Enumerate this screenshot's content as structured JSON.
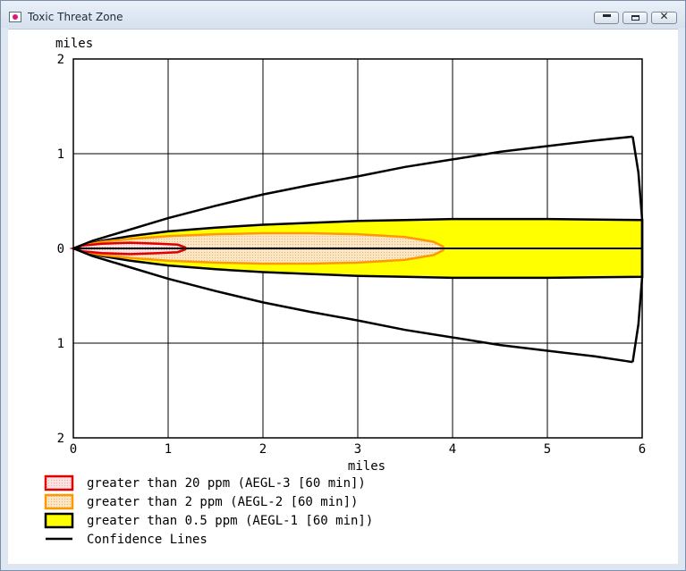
{
  "window": {
    "title": "Toxic Threat Zone",
    "icon": "app-window-icon"
  },
  "controls": {
    "minimize_icon": "minimize-icon",
    "maximize_icon": "maximize-icon",
    "close_icon": "close-icon",
    "close_glyph": "✕"
  },
  "chart_data": {
    "type": "area",
    "xlabel": "miles",
    "ylabel": "miles",
    "xlim": [
      0,
      6
    ],
    "ylim": [
      -2,
      2
    ],
    "x_ticks": [
      0,
      1,
      2,
      3,
      4,
      5,
      6
    ],
    "x_tick_labels": [
      "0",
      "1",
      "2",
      "3",
      "4",
      "5",
      "6"
    ],
    "y_ticks": [
      2,
      1,
      0,
      -1,
      -2
    ],
    "y_tick_labels": [
      "2",
      "1",
      "0",
      "1",
      "2"
    ],
    "grid": true,
    "legend_placement": "bottom-left",
    "centerline": [
      [
        0,
        0
      ],
      [
        6,
        0
      ]
    ],
    "zones": [
      {
        "name": "greater than 0.5 ppm (AEGL-1 [60 min])",
        "fill": "#ffff00",
        "stroke": "#000000",
        "upper": [
          [
            0,
            0
          ],
          [
            0.1,
            0.03
          ],
          [
            0.3,
            0.08
          ],
          [
            0.6,
            0.13
          ],
          [
            1,
            0.18
          ],
          [
            1.5,
            0.22
          ],
          [
            2,
            0.25
          ],
          [
            2.5,
            0.27
          ],
          [
            3,
            0.29
          ],
          [
            3.5,
            0.3
          ],
          [
            4,
            0.31
          ],
          [
            5,
            0.31
          ],
          [
            6,
            0.3
          ]
        ],
        "lower": [
          [
            0,
            0
          ],
          [
            0.1,
            -0.03
          ],
          [
            0.3,
            -0.08
          ],
          [
            0.6,
            -0.13
          ],
          [
            1,
            -0.18
          ],
          [
            1.5,
            -0.22
          ],
          [
            2,
            -0.25
          ],
          [
            2.5,
            -0.27
          ],
          [
            3,
            -0.29
          ],
          [
            3.5,
            -0.3
          ],
          [
            4,
            -0.31
          ],
          [
            5,
            -0.31
          ],
          [
            6,
            -0.3
          ]
        ]
      },
      {
        "name": "greater than 2 ppm (AEGL-2 [60 min])",
        "fill": "#fbe6bf",
        "stroke": "#ff9900",
        "upper": [
          [
            0,
            0
          ],
          [
            0.1,
            0.03
          ],
          [
            0.3,
            0.07
          ],
          [
            0.6,
            0.1
          ],
          [
            1,
            0.13
          ],
          [
            1.5,
            0.15
          ],
          [
            2,
            0.16
          ],
          [
            2.5,
            0.16
          ],
          [
            3,
            0.15
          ],
          [
            3.5,
            0.12
          ],
          [
            3.8,
            0.07
          ],
          [
            3.9,
            0.02
          ]
        ],
        "lower": [
          [
            0,
            0
          ],
          [
            0.1,
            -0.03
          ],
          [
            0.3,
            -0.07
          ],
          [
            0.6,
            -0.1
          ],
          [
            1,
            -0.13
          ],
          [
            1.5,
            -0.15
          ],
          [
            2,
            -0.16
          ],
          [
            2.5,
            -0.16
          ],
          [
            3,
            -0.15
          ],
          [
            3.5,
            -0.12
          ],
          [
            3.8,
            -0.07
          ],
          [
            3.9,
            -0.02
          ]
        ]
      },
      {
        "name": "greater than 20 ppm (AEGL-3 [60 min])",
        "fill": "#fbe1e1",
        "stroke": "#e00000",
        "upper": [
          [
            0,
            0
          ],
          [
            0.1,
            0.03
          ],
          [
            0.3,
            0.05
          ],
          [
            0.6,
            0.06
          ],
          [
            0.9,
            0.05
          ],
          [
            1.1,
            0.04
          ],
          [
            1.18,
            0.01
          ]
        ],
        "lower": [
          [
            0,
            0
          ],
          [
            0.1,
            -0.03
          ],
          [
            0.3,
            -0.05
          ],
          [
            0.6,
            -0.06
          ],
          [
            0.9,
            -0.05
          ],
          [
            1.1,
            -0.04
          ],
          [
            1.18,
            -0.01
          ]
        ]
      }
    ],
    "confidence_lines": {
      "name": "Confidence Lines",
      "color": "#000000",
      "upper": [
        [
          0,
          0
        ],
        [
          0.2,
          0.08
        ],
        [
          0.5,
          0.17
        ],
        [
          1,
          0.32
        ],
        [
          1.5,
          0.45
        ],
        [
          2,
          0.57
        ],
        [
          2.5,
          0.67
        ],
        [
          3,
          0.76
        ],
        [
          3.5,
          0.86
        ],
        [
          4,
          0.94
        ],
        [
          4.5,
          1.02
        ],
        [
          5,
          1.08
        ],
        [
          5.5,
          1.14
        ],
        [
          5.9,
          1.18
        ]
      ],
      "lower": [
        [
          0,
          0
        ],
        [
          0.2,
          -0.08
        ],
        [
          0.5,
          -0.17
        ],
        [
          1,
          -0.32
        ],
        [
          1.5,
          -0.45
        ],
        [
          2,
          -0.57
        ],
        [
          2.5,
          -0.67
        ],
        [
          3,
          -0.76
        ],
        [
          3.5,
          -0.86
        ],
        [
          4,
          -0.94
        ],
        [
          4.5,
          -1.02
        ],
        [
          5,
          -1.08
        ],
        [
          5.5,
          -1.14
        ],
        [
          5.9,
          -1.2
        ]
      ],
      "arc": [
        [
          5.9,
          1.18
        ],
        [
          5.96,
          0.8
        ],
        [
          6,
          0.3
        ],
        [
          6,
          0
        ],
        [
          6,
          -0.3
        ],
        [
          5.96,
          -0.8
        ],
        [
          5.9,
          -1.2
        ]
      ]
    },
    "legend": [
      {
        "label": "greater than 20 ppm (AEGL-3 [60 min])",
        "swatch_fill": "#fbe1e1",
        "swatch_stroke": "#e00000",
        "kind": "box"
      },
      {
        "label": "greater than 2 ppm (AEGL-2 [60 min])",
        "swatch_fill": "#fbe6bf",
        "swatch_stroke": "#ff9900",
        "kind": "box"
      },
      {
        "label": "greater than 0.5 ppm (AEGL-1 [60 min])",
        "swatch_fill": "#ffff00",
        "swatch_stroke": "#000000",
        "kind": "box"
      },
      {
        "label": "Confidence Lines",
        "swatch_fill": "",
        "swatch_stroke": "#000000",
        "kind": "line"
      }
    ]
  }
}
